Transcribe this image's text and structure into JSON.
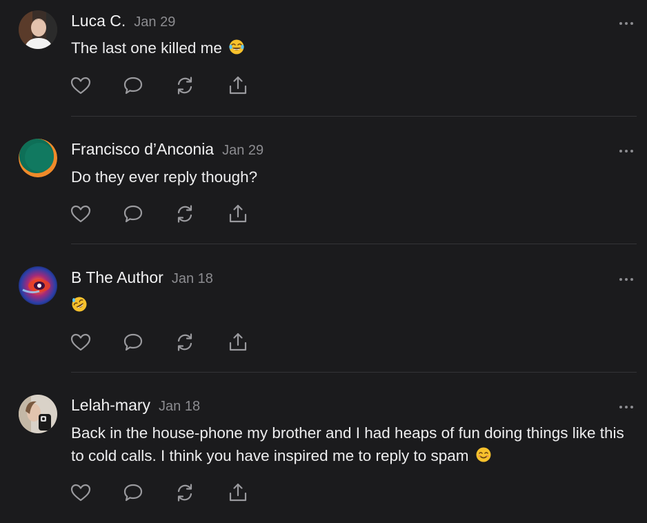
{
  "comments": [
    {
      "author": "Luca C.",
      "date": "Jan 29",
      "text": "The last one killed me",
      "emoji_icon": "face-with-tears-of-joy-icon",
      "avatar": "avatar-photo-man"
    },
    {
      "author": "Francisco d’Anconia",
      "date": "Jan 29",
      "text": "Do they ever reply though?",
      "avatar": "avatar-green-orange-circle"
    },
    {
      "author": "B The Author",
      "date": "Jan 18",
      "text": "",
      "emoji_icon": "rolling-on-floor-laughing-icon",
      "avatar": "avatar-cosmic-eye"
    },
    {
      "author": "Lelah-mary",
      "date": "Jan 18",
      "text": "Back in the house-phone my brother and I had heaps of fun doing things like this to cold calls. I think you have inspired me to reply to spam",
      "emoji_icon": "smiling-face-icon",
      "avatar": "avatar-photo-woman"
    }
  ],
  "actions": [
    "heart-icon",
    "comment-icon",
    "restack-icon",
    "share-icon"
  ],
  "colors": {
    "background": "#1b1b1d",
    "text": "#ededee",
    "muted": "#8c8c90",
    "icon": "#9a9a9e",
    "divider": "#343437"
  }
}
